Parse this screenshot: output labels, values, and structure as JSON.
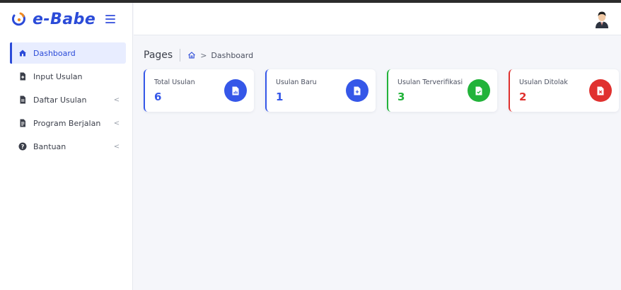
{
  "app": {
    "brand": "e-Babe"
  },
  "sidebar": {
    "items": [
      {
        "label": "Dashboard",
        "icon": "dashboard-icon",
        "active": true,
        "has_submenu": false
      },
      {
        "label": "Input Usulan",
        "icon": "file-plus-icon",
        "active": false,
        "has_submenu": false
      },
      {
        "label": "Daftar Usulan",
        "icon": "file-list-icon",
        "active": false,
        "has_submenu": true
      },
      {
        "label": "Program Berjalan",
        "icon": "document-icon",
        "active": false,
        "has_submenu": true
      },
      {
        "label": "Bantuan",
        "icon": "help-icon",
        "active": false,
        "has_submenu": true
      }
    ]
  },
  "breadcrumb": {
    "title": "Pages",
    "current": "Dashboard"
  },
  "cards": [
    {
      "label": "Total Usulan",
      "value": "6",
      "color": "#3557e8",
      "icon": "chart-file-icon"
    },
    {
      "label": "Usulan Baru",
      "value": "1",
      "color": "#3557e8",
      "icon": "new-file-icon"
    },
    {
      "label": "Usulan Terverifikasi",
      "value": "3",
      "color": "#22b33a",
      "icon": "check-file-icon"
    },
    {
      "label": "Usulan Ditolak",
      "value": "2",
      "color": "#e0312f",
      "icon": "x-file-icon"
    }
  ],
  "colors": {
    "accent": "#2b4bd8",
    "active_bg": "#e8edff",
    "page_bg": "#f5f6fa"
  }
}
